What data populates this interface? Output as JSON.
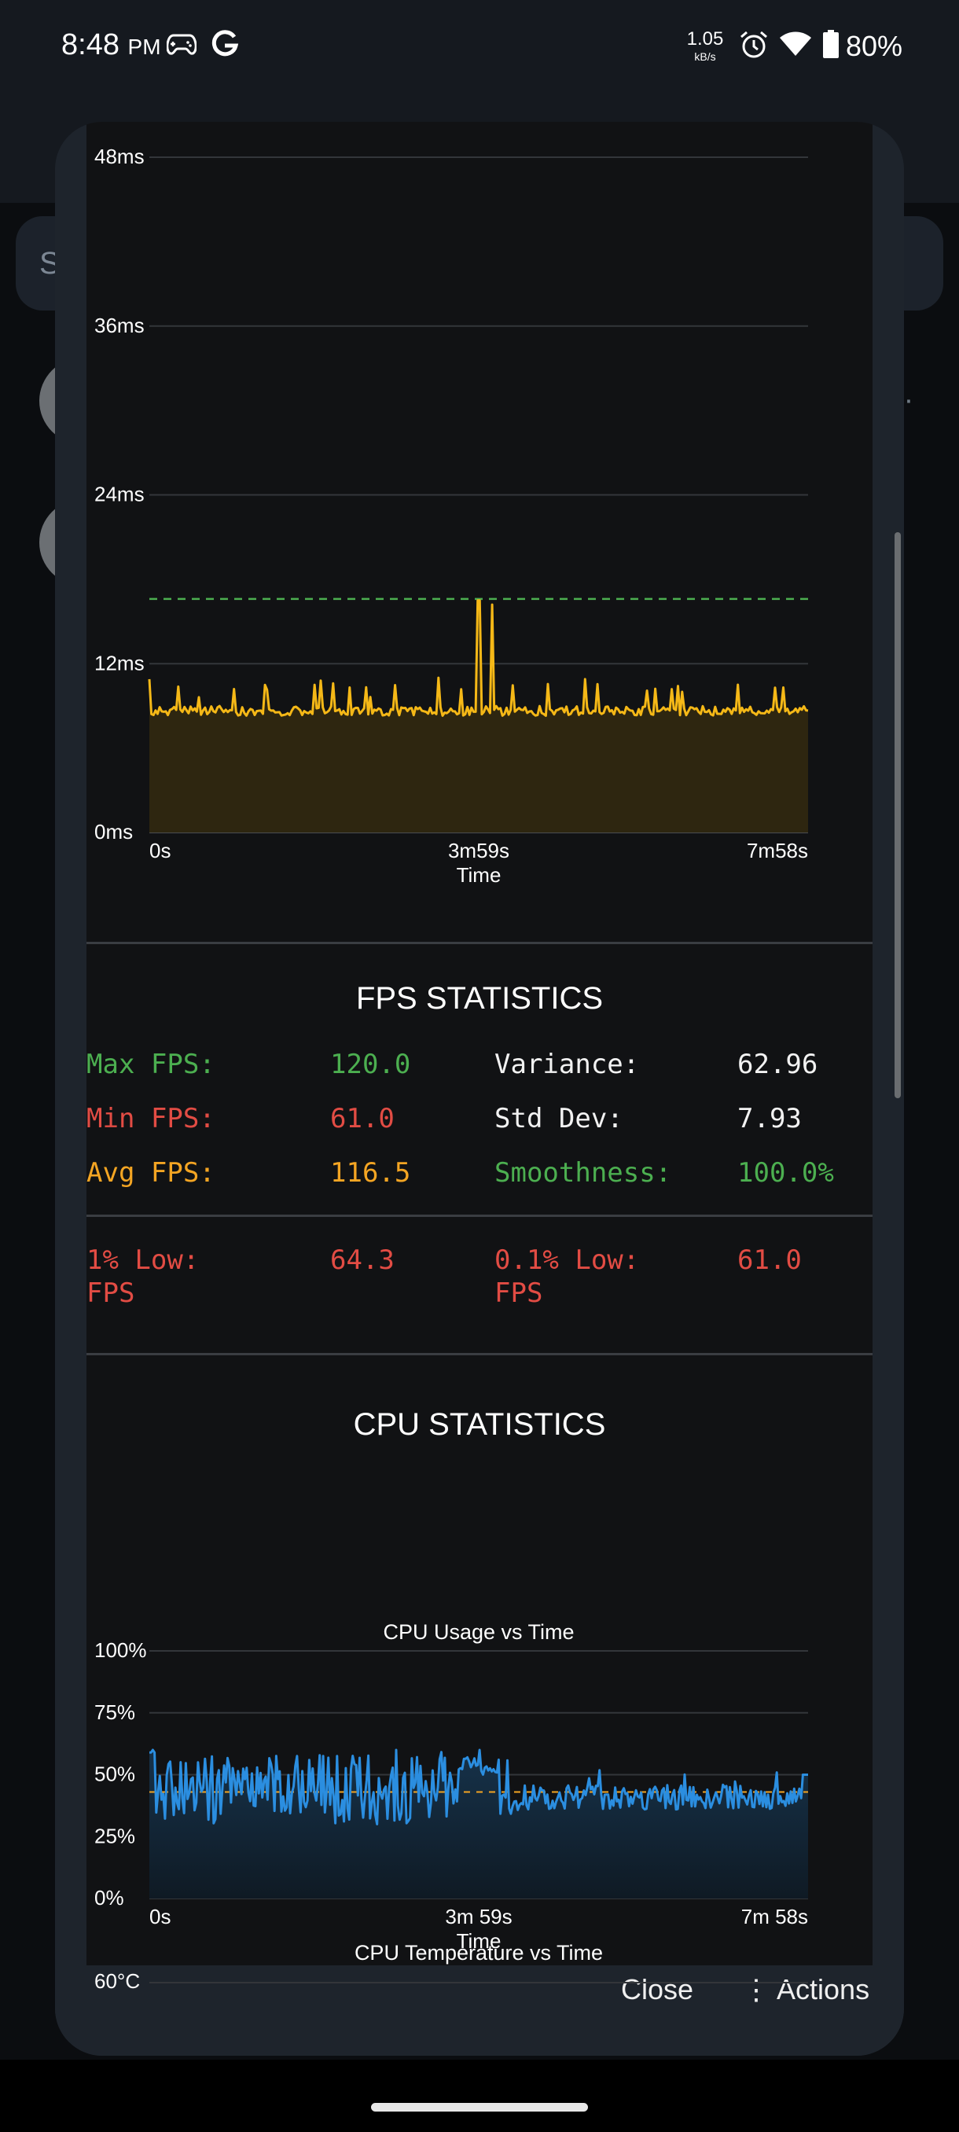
{
  "status_bar": {
    "time": "8:48",
    "ampm": "PM",
    "net_speed_value": "1.05",
    "net_speed_unit": "kB/s",
    "battery": "80%",
    "icons": [
      "gamepad-icon",
      "google-icon",
      "alarm-icon",
      "wifi-icon",
      "battery-icon"
    ]
  },
  "background": {
    "search_partial": "S"
  },
  "frame_chart": {
    "chart_data": {
      "type": "area",
      "y_ticks": [
        "48ms",
        "36ms",
        "24ms",
        "12ms",
        "0ms"
      ],
      "ylim": [
        0,
        48
      ],
      "x_ticks": [
        "0s",
        "3m59s",
        "7m58s"
      ],
      "xlabel": "Time",
      "threshold": 16.6,
      "baseline": 8.3,
      "spikes": [
        [
          0.0,
          10.9
        ],
        [
          0.13,
          10.2
        ],
        [
          0.25,
          10.5
        ],
        [
          0.26,
          10.8
        ],
        [
          0.28,
          10.6
        ],
        [
          0.44,
          11.0
        ],
        [
          0.5,
          16.5
        ],
        [
          0.52,
          16.2
        ],
        [
          0.66,
          10.9
        ],
        [
          0.81,
          10.0
        ],
        [
          0.95,
          10.3
        ]
      ],
      "colors": {
        "line": "#f5b817",
        "fill": "#2e2610",
        "threshold": "#4caf50"
      }
    }
  },
  "fps_statistics": {
    "title": "FPS STATISTICS",
    "max_label": "Max FPS:",
    "max_value": "120.0",
    "min_label": "Min FPS:",
    "min_value": "61.0",
    "avg_label": "Avg FPS:",
    "avg_value": "116.5",
    "variance_label": "Variance:",
    "variance_value": "62.96",
    "stddev_label": "Std Dev:",
    "stddev_value": "7.93",
    "smooth_label": "Smoothness:",
    "smooth_value": "100.0%",
    "low1_label": "1% Low:\nFPS",
    "low1_value": "64.3",
    "low01_label": "0.1% Low:\nFPS",
    "low01_value": "61.0"
  },
  "cpu_statistics": {
    "title": "CPU STATISTICS",
    "chart_data": {
      "type": "area",
      "title": "CPU Usage vs Time",
      "y_ticks": [
        "100%",
        "75%",
        "50%",
        "25%",
        "0%"
      ],
      "ylim": [
        0,
        100
      ],
      "x_ticks": [
        "0s",
        "3m 59s",
        "7m 58s"
      ],
      "xlabel": "Time",
      "average": 43,
      "colors": {
        "line": "#2b8ee0",
        "fill": "#16324a",
        "average": "#f4a523"
      }
    },
    "temp_chart_title": "CPU Temperature vs Time",
    "temp_first_tick": "60°C"
  },
  "actions": {
    "close_label": "Close",
    "actions_label": "⋮ Actions"
  }
}
